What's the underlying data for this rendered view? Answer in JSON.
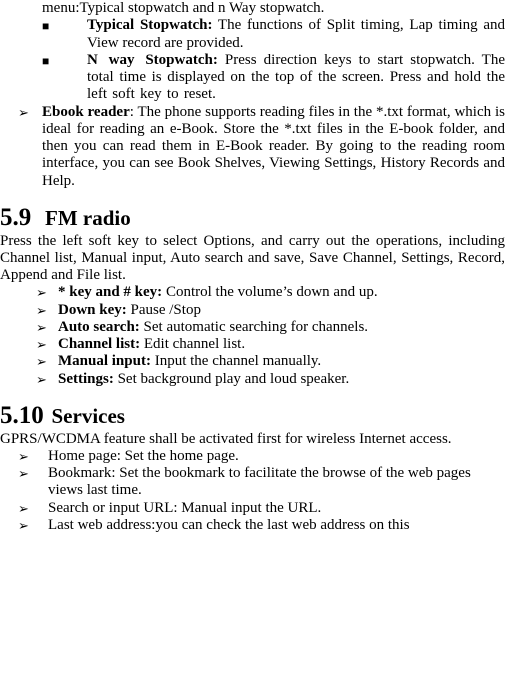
{
  "top": {
    "menu_line": "menu:Typical stopwatch and n Way stopwatch.",
    "typical_b": "Typical Stopwatch:",
    "typical_txt": " The functions of Split timing, Lap timing and View record are provided.",
    "nway_b": "N way Stopwatch:",
    "nway_txt": " Press direction keys to start stopwatch. The total time is displayed on the top of the screen. Press and hold the left soft key to reset.",
    "ebook_b": "Ebook reader",
    "ebook_txt": ": The phone supports reading files in the *.txt format, which is ideal for reading an e-Book. Store the *.txt files in the E-book folder, and then you can read them in E-Book reader. By going to the reading room interface, you can see Book Shelves, Viewing Settings, History Records and Help."
  },
  "fm": {
    "num": "5.9",
    "title": "FM radio",
    "intro": "Press the left soft key to select Options, and carry out the operations, including Channel list, Manual input, Auto search and save, Save Channel, Settings, Record, Append and File list.",
    "items": [
      {
        "b": "* key and # key:",
        "t": " Control the volume’s down and up."
      },
      {
        "b": "Down key:",
        "t": " Pause /Stop"
      },
      {
        "b": "Auto search:",
        "t": " Set automatic searching for channels."
      },
      {
        "b": "Channel list:",
        "t": " Edit channel list."
      },
      {
        "b": "Manual input:",
        "t": " Input the channel manually."
      },
      {
        "b": "Settings:",
        "t": " Set background play and loud speaker."
      }
    ]
  },
  "services": {
    "num": "5.10",
    "title": "Services",
    "intro": "GPRS/WCDMA feature shall be activated first for wireless Internet access.",
    "items": [
      "Home page: Set the home page.",
      "Bookmark: Set the bookmark to facilitate the browse of the web pages views last time.",
      "Search or input URL: Manual input the URL.",
      "Last web address:you can check the last web address on this"
    ]
  }
}
